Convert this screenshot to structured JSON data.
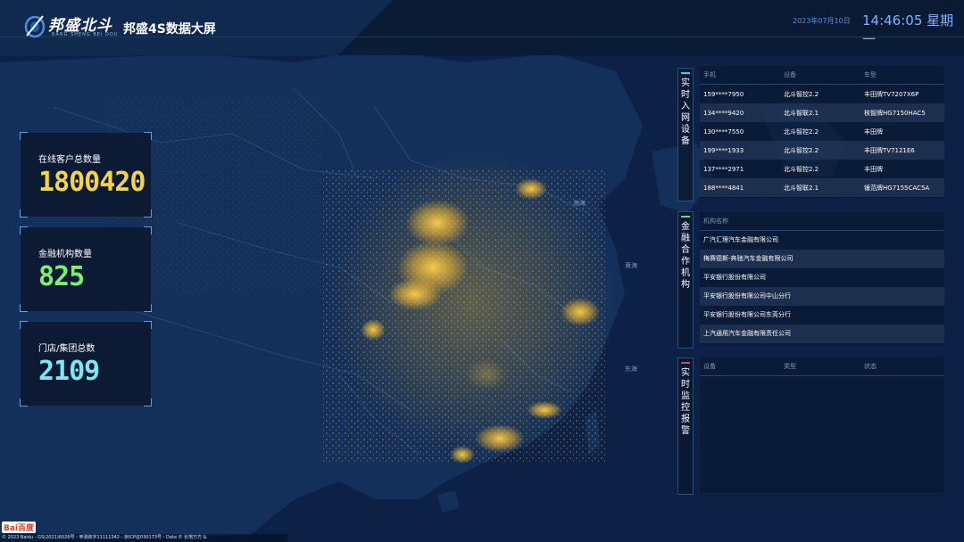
{
  "header": {
    "logo_text": "邦盛北斗",
    "logo_sub": "BANG SHENG BEI DOU",
    "title": "邦盛4S数据大屏",
    "date": "2023年07月10日",
    "time": "14:46:05 星期一"
  },
  "stats": [
    {
      "label": "在线客户总数量",
      "value": "1800420",
      "color": "#f6d24a"
    },
    {
      "label": "金融机构数量",
      "value": "825",
      "color": "#7bf070"
    },
    {
      "label": "门店/集团总数",
      "value": "2109",
      "color": "#7ce7f2"
    }
  ],
  "devices_panel": {
    "tab_label": "实时入网设备",
    "accent": "#4ac7ee",
    "headers": [
      "手机",
      "设备",
      "车型"
    ],
    "rows": [
      [
        "159****7950",
        "北斗智控2.2",
        "丰田牌TV7207X6P"
      ],
      [
        "134****9420",
        "北斗智联2.1",
        "核智牌HG7150HAC5"
      ],
      [
        "130****7550",
        "北斗智控2.2",
        "丰田牌"
      ],
      [
        "199****1933",
        "北斗智控2.2",
        "丰田牌TV7121E6"
      ],
      [
        "137****2971",
        "北斗智控2.2",
        "丰田牌"
      ],
      [
        "188****4841",
        "北斗智联2.1",
        "锤范牌HG7155CAC5A"
      ]
    ]
  },
  "finance_panel": {
    "tab_label": "金融合作机构",
    "accent": "#5fe06a",
    "header": "机构名称",
    "rows": [
      "广汽汇理汽车金融有限公司",
      "梅赛德斯-奔驰汽车金融有限公司",
      "平安银行股份有限公司",
      "平安银行股份有限公司中山分行",
      "平安银行股份有限公司东莞分行",
      "上汽通用汽车金融有限责任公司"
    ]
  },
  "alarm_panel": {
    "tab_label": "实时监控报警",
    "accent": "#e0484a",
    "headers": [
      "设备",
      "类型",
      "状态"
    ]
  },
  "map": {
    "labels": [
      "渤海",
      "黄海",
      "东海"
    ],
    "baidu_logo": "Bai百度",
    "copyright": "© 2023 Baidu - GS(2021)6026号 - 甲测资字11111342 - 京ICP证030173号 - Data © 长地万方 &"
  }
}
